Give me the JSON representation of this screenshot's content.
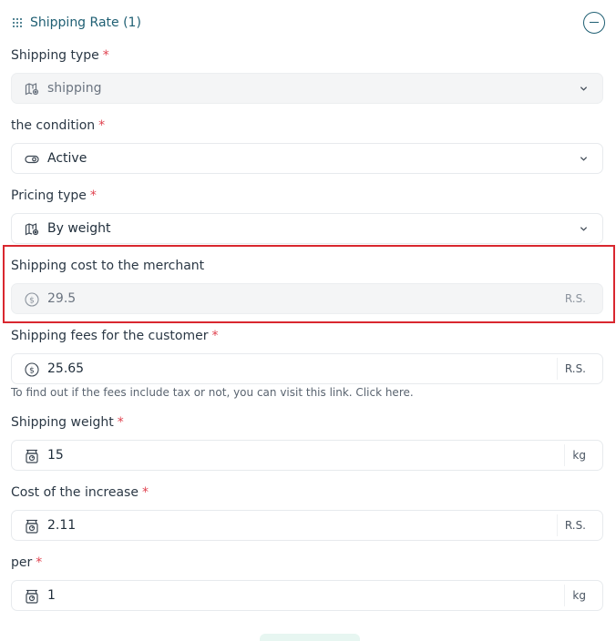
{
  "header": {
    "title": "Shipping Rate (1)"
  },
  "fields": {
    "shipping_type": {
      "label": "Shipping type",
      "required": "*",
      "value": "shipping"
    },
    "condition": {
      "label": "the condition",
      "required": "*",
      "value": "Active"
    },
    "pricing_type": {
      "label": "Pricing type",
      "required": "*",
      "value": "By weight"
    },
    "merchant_cost": {
      "label": "Shipping cost to the merchant",
      "value": "29.5",
      "suffix": "R.S."
    },
    "customer_fees": {
      "label": "Shipping fees for the customer",
      "required": "*",
      "value": "25.65",
      "suffix": "R.S."
    },
    "helper_text": "To find out if the fees include tax or not, you can visit this link. Click here.",
    "shipping_weight": {
      "label": "Shipping weight",
      "required": "*",
      "value": "15",
      "suffix": "kg"
    },
    "increase_cost": {
      "label": "Cost of the increase",
      "required": "*",
      "value": "2.11",
      "suffix": "R.S."
    },
    "per": {
      "label": "per",
      "required": "*",
      "value": "1",
      "suffix": "kg"
    }
  },
  "colors": {
    "accent": "#1f5f73",
    "required": "#e0424f",
    "highlight": "#d9272f"
  }
}
